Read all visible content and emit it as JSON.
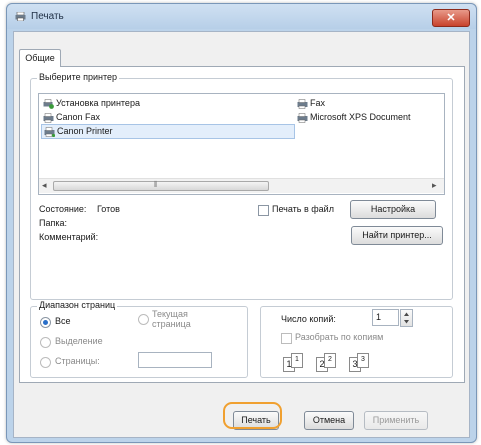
{
  "window": {
    "title": "Печать",
    "close_glyph": "✕"
  },
  "tabs": [
    {
      "label": "Общие"
    }
  ],
  "printer_group": {
    "label": "Выберите принтер",
    "printers": [
      {
        "name": "Установка принтера",
        "icon": "add-printer-icon"
      },
      {
        "name": "Fax",
        "icon": "fax-printer-icon"
      },
      {
        "name": "Canon Fax",
        "icon": "fax-printer-icon"
      },
      {
        "name": "Microsoft XPS Document",
        "icon": "printer-icon"
      },
      {
        "name": "Canon Printer",
        "icon": "printer-icon",
        "selected": true
      }
    ],
    "scroll_left": "◂",
    "scroll_right": "▸",
    "scroll_grip": "⦀"
  },
  "status": {
    "state_label": "Состояние:",
    "state_value": "Готов",
    "folder_label": "Папка:",
    "comment_label": "Комментарий:"
  },
  "print_to_file_label": "Печать в файл",
  "buttons": {
    "settings": "Настройка",
    "find_printer": "Найти принтер...",
    "print": "Печать",
    "cancel": "Отмена",
    "apply": "Применить"
  },
  "page_range": {
    "label": "Диапазон страниц",
    "all": "Все",
    "current_line1": "Текущая",
    "current_line2": "страница",
    "selection": "Выделение",
    "pages": "Страницы:",
    "selected": "all"
  },
  "copies": {
    "label": "Число копий:",
    "value": "1",
    "collate_label": "Разобрать по копиям",
    "collate_checked": false,
    "sets": [
      {
        "page": "1",
        "sup": "1"
      },
      {
        "page": "2",
        "sup": "2"
      },
      {
        "page": "3",
        "sup": "3"
      }
    ],
    "pages_sheets": [
      {
        "page": "1",
        "sup": "1"
      },
      {
        "page": "2",
        "sup": "2"
      },
      {
        "page": "3",
        "sup": "3"
      }
    ]
  },
  "colors": {
    "accent": "#2a6fc9",
    "highlight_ring": "#f0a030",
    "close": "#c8422c"
  }
}
